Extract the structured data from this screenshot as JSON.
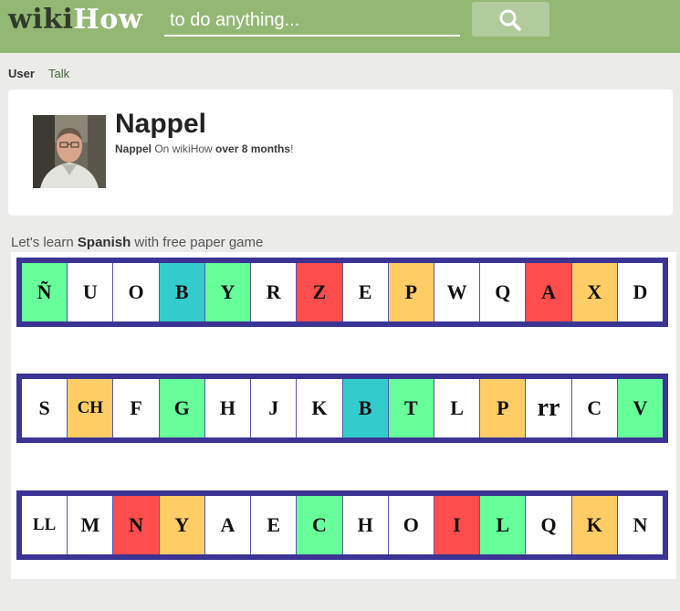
{
  "header": {
    "logo_part1": "wiki",
    "logo_part2": "How",
    "search_placeholder": "to do anything...",
    "search_icon": "magnifier-icon",
    "bg_color": "#93b874"
  },
  "tabs": [
    {
      "label": "User",
      "active": true
    },
    {
      "label": "Talk",
      "active": false
    }
  ],
  "profile": {
    "name": "Nappel",
    "meta_name": "Nappel",
    "meta_text": " On wikiHow ",
    "meta_duration": "over 8 months",
    "meta_suffix": "!"
  },
  "intro": {
    "prefix": "Let's learn ",
    "bold": "Spanish",
    "suffix": " with free paper game"
  },
  "colors": {
    "green": "#66ff99",
    "teal": "#33cccc",
    "red": "#ff4d4d",
    "orange": "#ffcc66",
    "white": "#ffffff",
    "border": "#3b3494"
  },
  "rows": [
    [
      {
        "t": "Ñ",
        "c": "green"
      },
      {
        "t": "U",
        "c": "white"
      },
      {
        "t": "O",
        "c": "white"
      },
      {
        "t": "B",
        "c": "teal"
      },
      {
        "t": "Y",
        "c": "green"
      },
      {
        "t": "R",
        "c": "white"
      },
      {
        "t": "Z",
        "c": "red"
      },
      {
        "t": "E",
        "c": "white"
      },
      {
        "t": "P",
        "c": "orange"
      },
      {
        "t": "W",
        "c": "white"
      },
      {
        "t": "Q",
        "c": "white"
      },
      {
        "t": "A",
        "c": "red"
      },
      {
        "t": "X",
        "c": "orange"
      },
      {
        "t": "D",
        "c": "white"
      }
    ],
    [
      {
        "t": "S",
        "c": "white"
      },
      {
        "t": "CH",
        "c": "orange"
      },
      {
        "t": "F",
        "c": "white"
      },
      {
        "t": "G",
        "c": "green"
      },
      {
        "t": "H",
        "c": "white"
      },
      {
        "t": "J",
        "c": "white"
      },
      {
        "t": "K",
        "c": "white"
      },
      {
        "t": "B",
        "c": "teal"
      },
      {
        "t": "T",
        "c": "green"
      },
      {
        "t": "L",
        "c": "white"
      },
      {
        "t": "P",
        "c": "orange"
      },
      {
        "t": "rr",
        "c": "white"
      },
      {
        "t": "C",
        "c": "white"
      },
      {
        "t": "V",
        "c": "green"
      }
    ],
    [
      {
        "t": "LL",
        "c": "white"
      },
      {
        "t": "M",
        "c": "white"
      },
      {
        "t": "N",
        "c": "red"
      },
      {
        "t": "Y",
        "c": "orange"
      },
      {
        "t": "A",
        "c": "white"
      },
      {
        "t": "E",
        "c": "white"
      },
      {
        "t": "C",
        "c": "green"
      },
      {
        "t": "H",
        "c": "white"
      },
      {
        "t": "O",
        "c": "white"
      },
      {
        "t": "I",
        "c": "red"
      },
      {
        "t": "L",
        "c": "green"
      },
      {
        "t": "Q",
        "c": "white"
      },
      {
        "t": "K",
        "c": "orange"
      },
      {
        "t": "N",
        "c": "white"
      }
    ]
  ]
}
